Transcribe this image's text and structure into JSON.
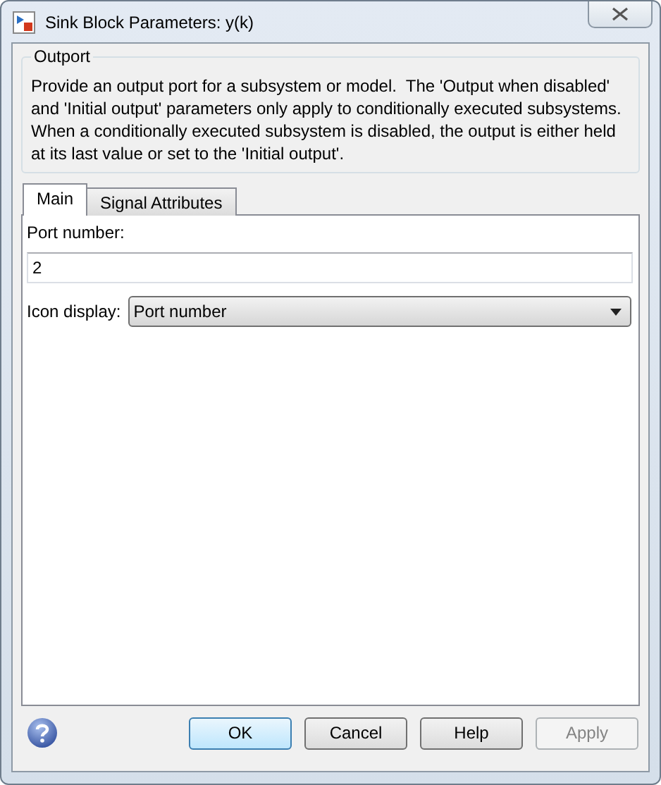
{
  "window": {
    "title": "Sink Block Parameters: y(k)"
  },
  "group": {
    "title": "Outport",
    "description": "Provide an output port for a subsystem or model.  The 'Output when disabled' and 'Initial output' parameters only apply to conditionally executed subsystems. When a conditionally executed subsystem is disabled, the output is either held at its last value or set to the 'Initial output'."
  },
  "tabs": [
    {
      "label": "Main",
      "selected": true
    },
    {
      "label": "Signal Attributes",
      "selected": false
    }
  ],
  "port_number": {
    "label": "Port number:",
    "value": "2"
  },
  "icon_display": {
    "label": "Icon display:",
    "value": "Port number"
  },
  "buttons": [
    {
      "label": "OK",
      "default": true,
      "disabled": false
    },
    {
      "label": "Cancel",
      "default": false,
      "disabled": false
    },
    {
      "label": "Help",
      "default": false,
      "disabled": false
    },
    {
      "label": "Apply",
      "default": false,
      "disabled": true
    }
  ]
}
